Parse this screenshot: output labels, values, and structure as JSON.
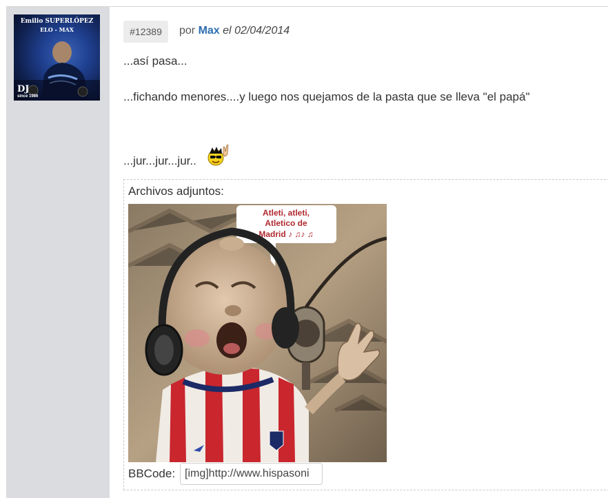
{
  "avatar": {
    "line1": "Emilio SUPERLÓPEZ",
    "line2": "ELO - MAX",
    "badge": "DJ",
    "since": "since 1986"
  },
  "post": {
    "number": "#12389",
    "by": "por",
    "author": "Max",
    "date_prefix": "el",
    "date": "02/04/2014",
    "lines": [
      "...así pasa...",
      "...fichando menores....y luego nos quejamos de la pasta que se lleva \"el papá\"",
      "...jur...jur...jur.."
    ],
    "emoji": "rock-on-smiley-icon"
  },
  "attachments": {
    "label": "Archivos adjuntos:",
    "image_caption": "Atleti, atleti, Atletico de Madrid ♪ ♫♪ ♫",
    "bbcode_label": "BBCode:",
    "bbcode_value": "[img]http://www.hispasoni"
  },
  "colors": {
    "author_link": "#2a6db0",
    "sidebar_bg": "#dbdcdf",
    "jersey_red": "#c9262e"
  }
}
